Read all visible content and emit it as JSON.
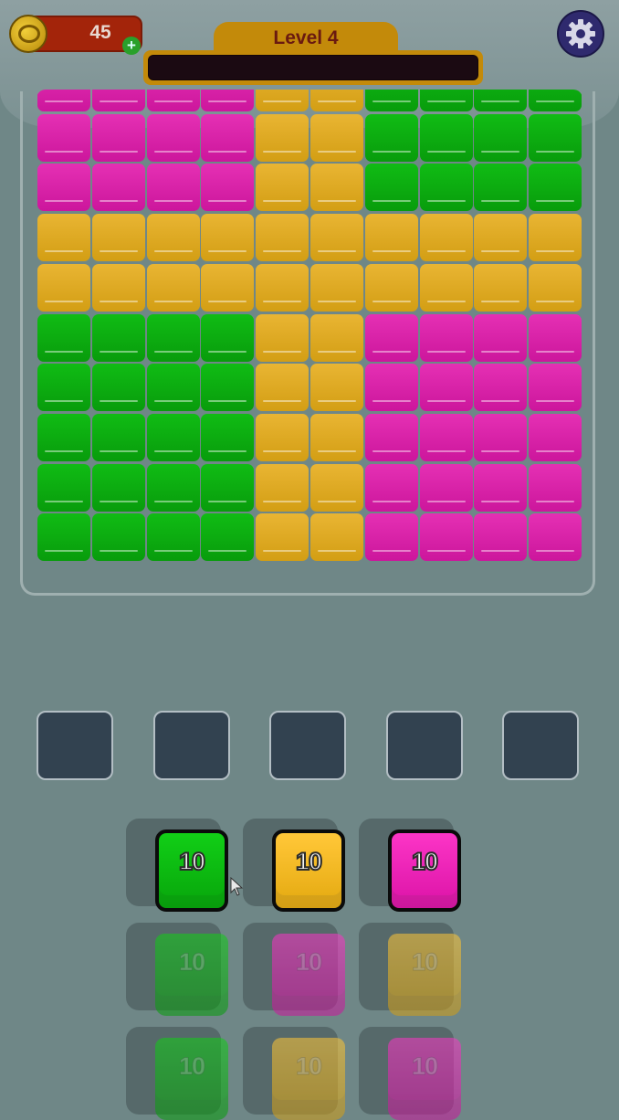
{
  "hud": {
    "coins": "45",
    "add_label": "+",
    "level_label": "Level 4",
    "level_progress": 0,
    "settings_icon": "gear-icon"
  },
  "board": {
    "columns": 10,
    "rows": 10,
    "colors": {
      "pink": "#e028ae",
      "yellow": "#e0aa20",
      "green": "#0cae10"
    },
    "grid": [
      [
        "pink",
        "pink",
        "pink",
        "pink",
        "yellow",
        "yellow",
        "green",
        "green",
        "green",
        "green"
      ],
      [
        "pink",
        "pink",
        "pink",
        "pink",
        "yellow",
        "yellow",
        "green",
        "green",
        "green",
        "green"
      ],
      [
        "pink",
        "pink",
        "pink",
        "pink",
        "yellow",
        "yellow",
        "green",
        "green",
        "green",
        "green"
      ],
      [
        "yellow",
        "yellow",
        "yellow",
        "yellow",
        "yellow",
        "yellow",
        "yellow",
        "yellow",
        "yellow",
        "yellow"
      ],
      [
        "yellow",
        "yellow",
        "yellow",
        "yellow",
        "yellow",
        "yellow",
        "yellow",
        "yellow",
        "yellow",
        "yellow"
      ],
      [
        "green",
        "green",
        "green",
        "green",
        "yellow",
        "yellow",
        "pink",
        "pink",
        "pink",
        "pink"
      ],
      [
        "green",
        "green",
        "green",
        "green",
        "yellow",
        "yellow",
        "pink",
        "pink",
        "pink",
        "pink"
      ],
      [
        "green",
        "green",
        "green",
        "green",
        "yellow",
        "yellow",
        "pink",
        "pink",
        "pink",
        "pink"
      ],
      [
        "green",
        "green",
        "green",
        "green",
        "yellow",
        "yellow",
        "pink",
        "pink",
        "pink",
        "pink"
      ],
      [
        "green",
        "green",
        "green",
        "green",
        "yellow",
        "yellow",
        "pink",
        "pink",
        "pink",
        "pink"
      ]
    ]
  },
  "slots": {
    "count": 5
  },
  "queue": [
    [
      {
        "color": "green",
        "count": "10",
        "active": true
      },
      {
        "color": "yellow",
        "count": "10",
        "active": true
      },
      {
        "color": "pink",
        "count": "10",
        "active": true
      }
    ],
    [
      {
        "color": "green",
        "count": "10",
        "active": false
      },
      {
        "color": "pink",
        "count": "10",
        "active": false
      },
      {
        "color": "yellow",
        "count": "10",
        "active": false
      }
    ],
    [
      {
        "color": "green",
        "count": "10",
        "active": false
      },
      {
        "color": "yellow",
        "count": "10",
        "active": false
      },
      {
        "color": "pink",
        "count": "10",
        "active": false
      }
    ]
  ]
}
